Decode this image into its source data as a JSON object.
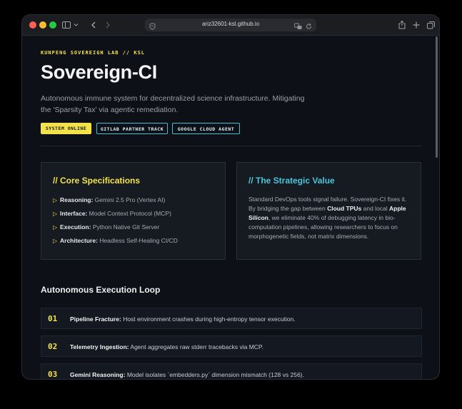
{
  "browser": {
    "url": "ariz32601-ksl.github.io"
  },
  "page": {
    "eyebrow": "KUNPENG SOVEREIGN LAB // KSL",
    "title": "Sovereign-CI",
    "subtitle": "Autonomous immune system for decentralized science infrastructure. Mitigating the 'Sparsity Tax' via agentic remediation.",
    "badges": [
      "SYSTEM ONLINE",
      "GITLAB PARTNER TRACK",
      "GOOGLE CLOUD AGENT"
    ]
  },
  "specs": {
    "title": "// Core Specifications",
    "items": [
      {
        "key": "Reasoning:",
        "value": "Gemini 2.5 Pro (Vertex AI)"
      },
      {
        "key": "Interface:",
        "value": "Model Context Protocol (MCP)"
      },
      {
        "key": "Execution:",
        "value": "Python Native Git Server"
      },
      {
        "key": "Architecture:",
        "value": "Headless Self-Healing CI/CD"
      }
    ]
  },
  "value": {
    "title": "// The Strategic Value",
    "t1": "Standard DevOps tools signal failure. Sovereign-CI fixes it. By bridging the gap between ",
    "b1": "Cloud TPUs",
    "t2": " and local ",
    "b2": "Apple Silicon",
    "t3": ", we eliminate 40% of debugging latency in bio-computation pipelines, allowing researchers to focus on morphogenetic fields, not matrix dimensions."
  },
  "loop": {
    "title": "Autonomous Execution Loop",
    "steps": [
      {
        "num": "01",
        "key": "Pipeline Fracture:",
        "text": "Host environment crashes during high-entropy tensor execution."
      },
      {
        "num": "02",
        "key": "Telemetry Ingestion:",
        "text": "Agent aggregates raw stderr tracebacks via MCP."
      },
      {
        "num": "03",
        "key": "Gemini Reasoning:",
        "text": "Model isolates `embedders.py` dimension mismatch (128 vs 256)."
      }
    ]
  },
  "icons": {
    "sidebar": "sidebar-icon",
    "back": "chevron-left-icon",
    "forward": "chevron-right-icon",
    "shield": "shield-icon",
    "translate": "translate-icon",
    "reload": "reload-icon",
    "share": "share-icon",
    "plus": "plus-icon",
    "tabs": "tabs-icon",
    "bullet": "triangle-right-icon"
  },
  "colors": {
    "accent_yellow": "#f4e24a",
    "accent_cyan": "#49c7da",
    "background": "#0d1017"
  }
}
